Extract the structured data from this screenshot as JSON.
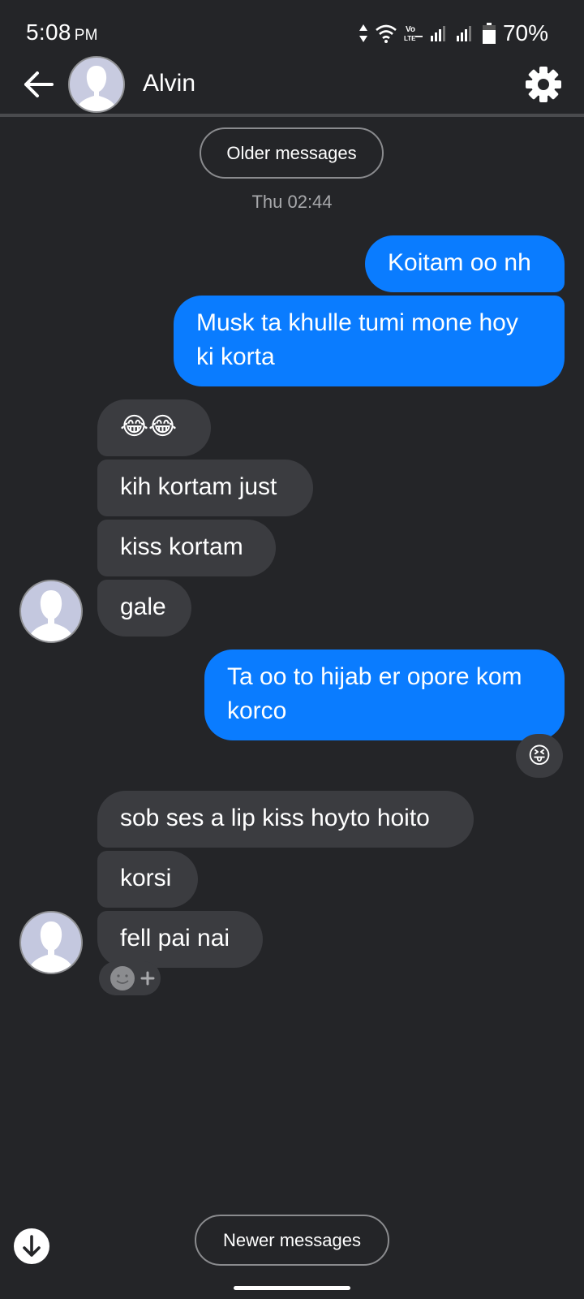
{
  "status_bar": {
    "time": "5:08",
    "ampm": "PM",
    "battery": "70%",
    "icons": [
      "data-arrows-icon",
      "wifi-icon",
      "volte-icon",
      "signal-icon",
      "signal-icon",
      "battery-icon"
    ]
  },
  "header": {
    "contact_name": "Alvin",
    "back_icon": "arrow-left-icon",
    "settings_icon": "gear-icon"
  },
  "conversation": {
    "older_label": "Older messages",
    "newer_label": "Newer messages",
    "date_label": "Thu 02:44",
    "messages": [
      {
        "direction": "outgoing",
        "text": "Koitam oo nh"
      },
      {
        "direction": "outgoing",
        "text": "Musk ta khulle tumi mone hoy ki korta"
      },
      {
        "direction": "incoming",
        "text": "😂😂"
      },
      {
        "direction": "incoming",
        "text": "kih kortam just"
      },
      {
        "direction": "incoming",
        "text": "kiss kortam"
      },
      {
        "direction": "incoming",
        "text": "gale"
      },
      {
        "direction": "outgoing",
        "text": "Ta oo to hijab er opore kom korco",
        "reaction": "😝"
      },
      {
        "direction": "incoming",
        "text": "sob ses a lip kiss hoyto hoito"
      },
      {
        "direction": "incoming",
        "text": "korsi"
      },
      {
        "direction": "incoming",
        "text": "fell pai nai"
      }
    ]
  },
  "colors": {
    "background": "#242528",
    "outgoing_bubble": "#0a7cff",
    "incoming_bubble": "#3b3c40"
  }
}
